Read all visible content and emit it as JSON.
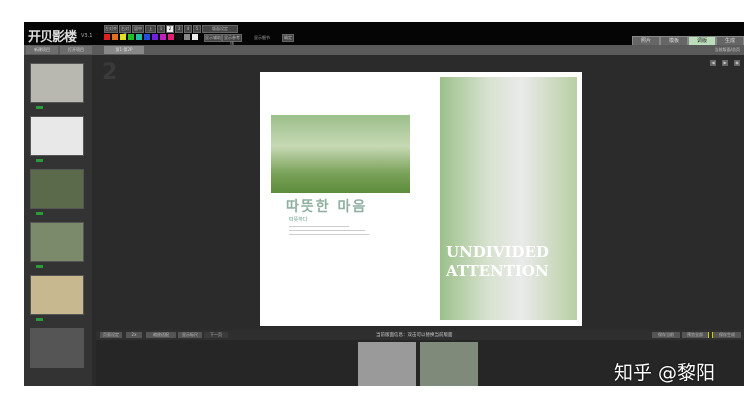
{
  "app": {
    "logo": "开贝影楼",
    "version": "V3.1"
  },
  "toolbar": {
    "buttons": [
      "左对齐",
      "右对齐",
      "居中",
      "上",
      "1",
      "2",
      "3",
      "4",
      "5"
    ],
    "apply_label": "版面设定",
    "aux": [
      "显示辅助",
      "显示参考线"
    ],
    "status": "显示细节",
    "ok": "确定",
    "swatches": [
      "#e02020",
      "#e07020",
      "#e0e020",
      "#20c020",
      "#20c0a0",
      "#2050e0",
      "#7020e0",
      "#c020c0",
      "#e02070",
      "#101010",
      "#888888",
      "#eeeeee"
    ]
  },
  "tabs": [
    "新建项目",
    "打开项目",
    "第1-第2P"
  ],
  "mode_buttons": [
    "照片",
    "模板",
    "调版",
    "生成"
  ],
  "active_mode": "调版",
  "sub_status": "当前版面/总页",
  "canvas": {
    "page_number": "2",
    "korean_title": "따뜻한 마음",
    "korean_sub": "따뜻하다",
    "headline_1": "UNDIVIDED",
    "headline_2": "ATTENTION"
  },
  "bottom": {
    "left": [
      "页面设定",
      "2x",
      "缩放适配",
      "显示标尺",
      "下一页"
    ],
    "center": "当前版面信息：双击可以替换当前版面",
    "right": [
      "保存当前",
      "预览全部",
      "保存生成"
    ]
  },
  "sidebar": {
    "pages": 6
  },
  "watermark": "知乎 @黎阳"
}
